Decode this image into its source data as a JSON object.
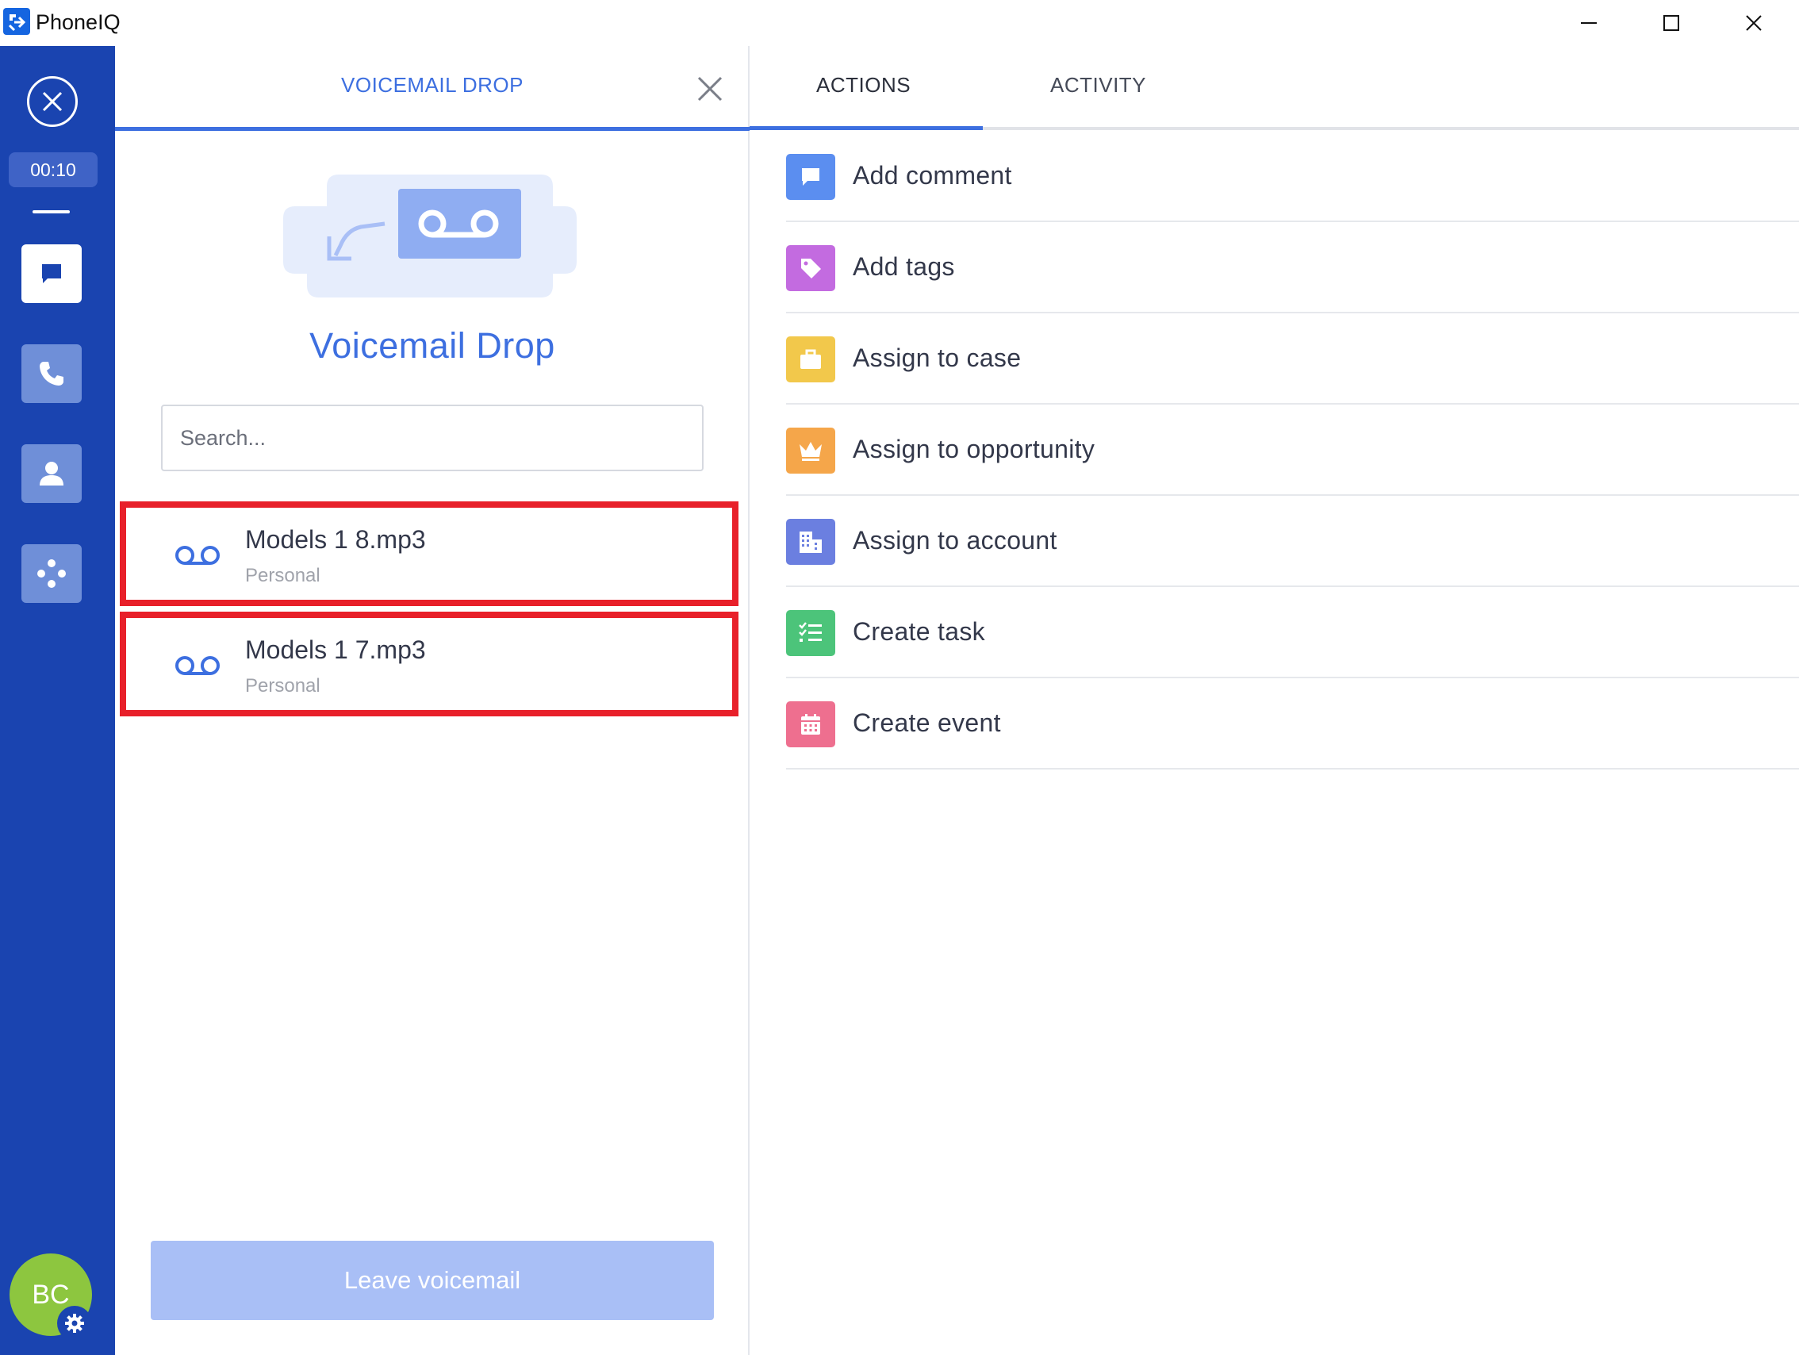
{
  "window": {
    "title": "PhoneIQ"
  },
  "rail": {
    "timer": "00:10",
    "avatar_initials": "BC"
  },
  "voicemail": {
    "tab_label": "VOICEMAIL DROP",
    "heading": "Voicemail Drop",
    "search_placeholder": "Search...",
    "items": [
      {
        "name": "Models 1 8.mp3",
        "category": "Personal"
      },
      {
        "name": "Models 1 7.mp3",
        "category": "Personal"
      }
    ],
    "leave_button": "Leave voicemail"
  },
  "actions_panel": {
    "tabs": [
      {
        "label": "ACTIONS",
        "active": true
      },
      {
        "label": "ACTIVITY",
        "active": false
      }
    ],
    "actions": [
      {
        "label": "Add comment",
        "icon": "comment-icon",
        "color": "#5b8ef0"
      },
      {
        "label": "Add tags",
        "icon": "tag-icon",
        "color": "#c36be0"
      },
      {
        "label": "Assign to case",
        "icon": "briefcase-icon",
        "color": "#f2c84b"
      },
      {
        "label": "Assign to opportunity",
        "icon": "crown-icon",
        "color": "#f5a64a"
      },
      {
        "label": "Assign to account",
        "icon": "building-icon",
        "color": "#6b7fe0"
      },
      {
        "label": "Create task",
        "icon": "checklist-icon",
        "color": "#4cc47a"
      },
      {
        "label": "Create event",
        "icon": "calendar-icon",
        "color": "#ee6f8f"
      }
    ]
  },
  "colors": {
    "rail": "#1a44b0",
    "accent": "#3d6fe0",
    "highlight_border": "#e8202a",
    "leave_button_disabled": "#a9bff6"
  }
}
